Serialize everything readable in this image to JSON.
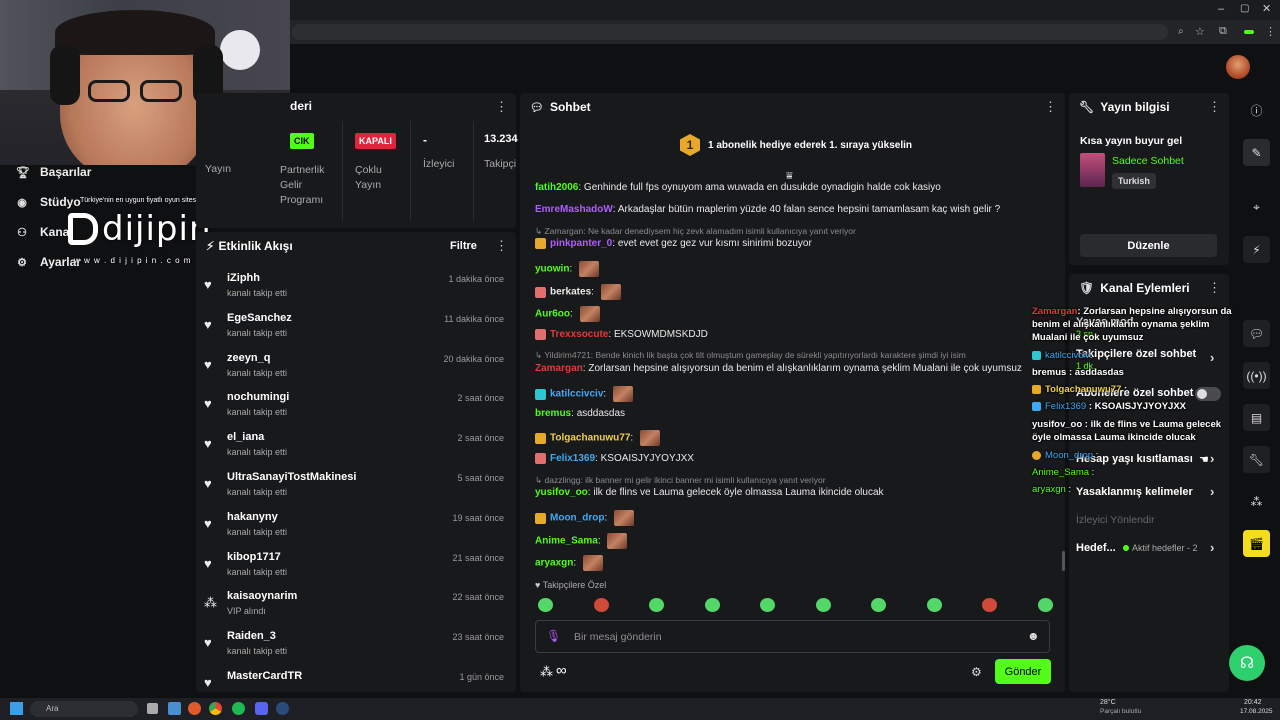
{
  "app": {
    "accent": "#53fc18",
    "panel_bg": "#18191b",
    "bg": "#0f1012"
  },
  "sidebar": {
    "items": [
      {
        "label": "Başarılar",
        "icon": "trophy-icon"
      },
      {
        "label": "Stüdyo",
        "icon": "studio-icon"
      },
      {
        "label": "Kanal",
        "icon": "users-icon"
      },
      {
        "label": "Ayarlar",
        "icon": "gear-icon"
      }
    ]
  },
  "watermark": {
    "tagline": "Türkiye'nin en uygun fiyatlı oyun sitesi",
    "brand": "dijipin",
    "url": "w w w . d i j i p i n . c o m"
  },
  "stats_panel": {
    "title": "deri",
    "items": [
      {
        "badge": "CIK",
        "label": "Yayın"
      },
      {
        "label": "Partnerlik\nGelir\nProgramı"
      },
      {
        "badge": "KAPALI",
        "label": "Çoklu\nYayın"
      },
      {
        "value": "-",
        "label": "İzleyici"
      },
      {
        "value": "13.234",
        "label": "Takipçi"
      }
    ]
  },
  "activity": {
    "title": "Etkinlik Akışı",
    "filter": "Filtre",
    "events": [
      {
        "name": "iZiphh",
        "action": "kanalı takip etti",
        "time": "1 dakika önce",
        "icon": "heart-icon"
      },
      {
        "name": "EgeSanchez",
        "action": "kanalı takip etti",
        "time": "11 dakika önce",
        "icon": "heart-icon"
      },
      {
        "name": "zeeyn_q",
        "action": "kanalı takip etti",
        "time": "20 dakika önce",
        "icon": "heart-icon"
      },
      {
        "name": "nochumingi",
        "action": "kanalı takip etti",
        "time": "2 saat önce",
        "icon": "heart-icon"
      },
      {
        "name": "el_iana",
        "action": "kanalı takip etti",
        "time": "2 saat önce",
        "icon": "heart-icon"
      },
      {
        "name": "UltraSanayiTostMakinesi",
        "action": "kanalı takip etti",
        "time": "5 saat önce",
        "icon": "heart-icon"
      },
      {
        "name": "hakanyny",
        "action": "kanalı takip etti",
        "time": "19 saat önce",
        "icon": "heart-icon"
      },
      {
        "name": "kibop1717",
        "action": "kanalı takip etti",
        "time": "21 saat önce",
        "icon": "heart-icon"
      },
      {
        "name": "kaisaoynarim",
        "action": "VIP alındı",
        "time": "22 saat önce",
        "icon": "vip-icon"
      },
      {
        "name": "Raiden_3",
        "action": "kanalı takip etti",
        "time": "23 saat önce",
        "icon": "heart-icon"
      },
      {
        "name": "MasterCardTR",
        "action": "",
        "time": "1 gün önce",
        "icon": "heart-icon"
      }
    ]
  },
  "chat": {
    "title": "Sohbet",
    "promo_number": "1",
    "promo": "1 abonelik hediye ederek 1. sıraya yükselin",
    "followers_only": "Takipçilere Özel",
    "placeholder": "Bir mesaj gönderin",
    "send": "Gönder",
    "messages": [
      {
        "user": "fatih2006",
        "color": "#53fc18",
        "text": "Genhinde full fps oynuyom ama wuwada en dusukde oynadigin halde cok kasiyo"
      },
      {
        "user": "EmreMashadoW",
        "color": "#b05cff",
        "text": "Arkadaşlar bütün maplerim yüzde 40 falan sence hepsini tamamlasam kaç wish gelir ?"
      },
      {
        "reply": "Zamargan: Ne kadar denediysem hiç zevk alamadım isimli kullanıcıya yanıt veriyor"
      },
      {
        "user": "pinkpanter_0",
        "color": "#b05cff",
        "text": "evet evet gez gez vur kısmı sinirimi bozuyor"
      },
      {
        "user": "yuowin",
        "color": "#53fc18",
        "text": ""
      },
      {
        "user": "berkates",
        "color": "#e8e8e8",
        "text": ""
      },
      {
        "user": "Aur6oo",
        "color": "#53fc18",
        "text": ""
      },
      {
        "user": "Trexxsocute",
        "color": "#e03b3b",
        "text": "EKSOWMDMSKDJD"
      },
      {
        "reply": "Yildirim4721: Bende kinich lik başta çok tilt olmuştum gameplay de sürekli yapıtırıyorlardı karaktere şimdi iyi isim"
      },
      {
        "user": "Zamargan",
        "color": "#e03b3b",
        "text": "Zorlarsan hepsine alışıyorsun da benim el alışkanlıklarım oynama şeklim Mualani ile çok uyumsuz"
      },
      {
        "user": "katilccivciv",
        "color": "#3fa9f5",
        "text": ""
      },
      {
        "user": "bremus",
        "color": "#53fc18",
        "text": "asddasdas"
      },
      {
        "user": "Tolgachanuwu77",
        "color": "#f0d04a",
        "text": ""
      },
      {
        "user": "Felix1369",
        "color": "#3fa9f5",
        "text": "KSOAISJYJYOYJXX"
      },
      {
        "reply": "dazzlingg: ilk banner mi gelir ikinci banner mi isimli kullanıcıya yanıt veriyor"
      },
      {
        "user": "yusifov_oo",
        "color": "#53fc18",
        "text": "ilk de flins ve Lauma gelecek öyle olmassa Lauma ikincide olucak"
      },
      {
        "user": "Moon_drop",
        "color": "#3fa9f5",
        "text": ""
      },
      {
        "user": "Anime_Sama",
        "color": "#53fc18",
        "text": ""
      },
      {
        "user": "aryaxgn",
        "color": "#53fc18",
        "text": ""
      }
    ]
  },
  "stream_info": {
    "title": "Yayın bilgisi",
    "stream_title": "Kısa yayın buyur gel",
    "category": "Sadece Sohbet",
    "tag": "Turkish",
    "edit": "Düzenle"
  },
  "channel_actions": {
    "title": "Kanal Eylemleri",
    "rows": [
      {
        "label": "Yavaş mod",
        "value": "3 sn."
      },
      {
        "label": "Takipçilere özel sohbet",
        "value": "1 dk."
      },
      {
        "label": "Abonelere özel sohbet"
      },
      {
        "label": "Hesap yaşı kısıtlaması"
      },
      {
        "label": "Yasaklanmış kelimeler"
      }
    ],
    "viewer_section": "İzleyici Yönlendir",
    "goals": "Hedef...",
    "goals_status": "Aktif hedefler - 2"
  },
  "overlay_chat": [
    {
      "user": "Zamargan",
      "color": "#e03b3b",
      "text": "Zorlarsan hepsine alışıyorsun da benim el alışkanlıklarım oynama şeklim Mualani ile çok uyumsuz"
    },
    {
      "user": "katilccivciv",
      "color": "#3fa9f5",
      "text": ""
    },
    {
      "user": "bremus",
      "color": "#fff",
      "text": "asddasdas"
    },
    {
      "user": "Tolgachanuwu77",
      "color": "#f0d04a",
      "text": ""
    },
    {
      "user": "Felix1369",
      "color": "#3fa9f5",
      "text": "KSOAISJYJYOYJXX"
    },
    {
      "user": "yusifov_oo",
      "color": "#fff",
      "text": "ilk de flins ve Lauma gelecek öyle olmassa Lauma ikincide olucak"
    },
    {
      "user": "Moon_drop",
      "color": "#3fa9f5",
      "text": ""
    },
    {
      "user": "Anime_Sama",
      "color": "#53fc18",
      "text": ""
    },
    {
      "user": "aryaxgn",
      "color": "#53fc18",
      "text": ""
    }
  ],
  "taskbar": {
    "search": "Ara",
    "weather_temp": "28°C",
    "weather_desc": "Parçalı bulutlu",
    "time": "20:42",
    "date": "17.08.2025"
  }
}
